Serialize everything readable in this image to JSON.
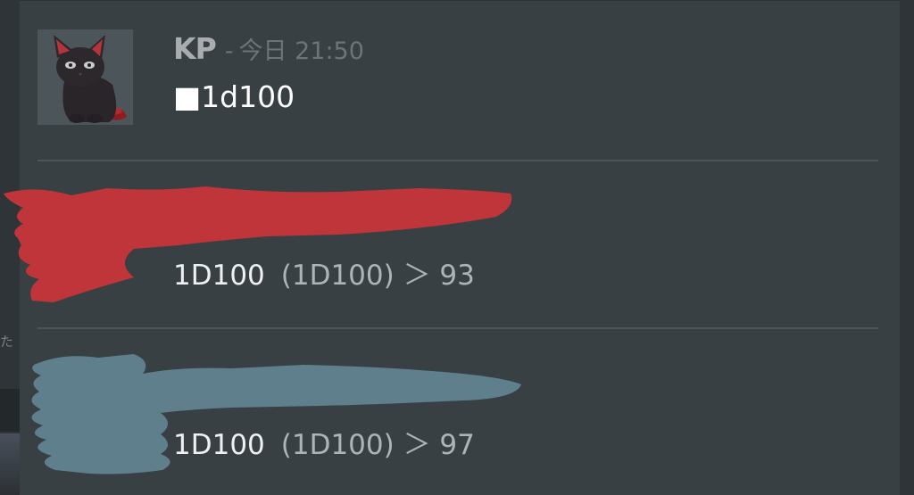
{
  "colors": {
    "background": "#2f3438",
    "panel": "#394043",
    "redaction_red": "#c03539",
    "redaction_blue": "#5f7f8c",
    "text_primary": "#ffffff",
    "text_muted": "#6d7377"
  },
  "message": {
    "author": "KP",
    "separator": "-",
    "timestamp": "今日 21:50",
    "content": "■1d100",
    "avatar_icon": "black-cat-avatar"
  },
  "results": [
    {
      "dice": "1D100",
      "detail": "(1D100) ＞ 93",
      "redaction_color": "#c03539"
    },
    {
      "dice": "1D100",
      "detail": "(1D100) ＞ 97",
      "redaction_color": "#5f7f8c"
    }
  ],
  "left_edge": {
    "fragment_text": "た"
  }
}
